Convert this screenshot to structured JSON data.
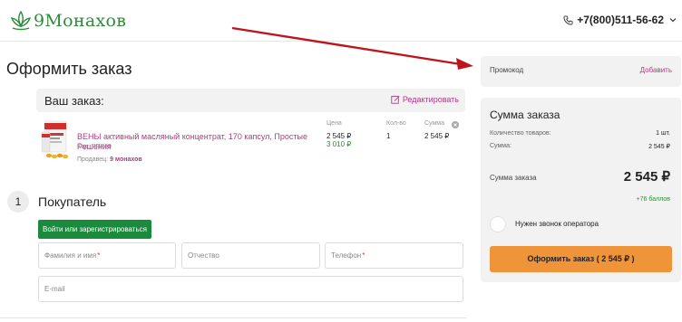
{
  "header": {
    "logo_text": "9Монахов",
    "phone": "+7(800)511-56-62"
  },
  "page": {
    "title": "Оформить заказ"
  },
  "order": {
    "heading": "Ваш заказ:",
    "edit_label": "Редактировать",
    "columns": {
      "price": "Цена",
      "qty": "Кол-во",
      "sum": "Сумма"
    },
    "item": {
      "name": "ВЕНЫ активный масляный концентрат, 170 капсул, Простые Решения",
      "code": "Код: РПР39",
      "seller_label": "Продавец:",
      "seller_name": "9 монахов",
      "price": "2 545 ₽",
      "price_old": "3 010 ₽",
      "qty": "1",
      "sum": "2 545 ₽"
    }
  },
  "buyer": {
    "step_number": "1",
    "title": "Покупатель",
    "login_button": "Войти или зарегистрироваться",
    "fields": {
      "surname_name": "Фамилия и имя",
      "patronymic": "Отчество",
      "phone": "Телефон",
      "email": "E-mail"
    },
    "required_mark": "*"
  },
  "promo": {
    "label": "Промокод",
    "add_label": "Добавить"
  },
  "summary": {
    "title": "Сумма заказа",
    "count_label": "Количество товаров:",
    "count_value": "1 шт.",
    "sum_label": "Сумма:",
    "sum_value": "2 545 ₽",
    "total_label": "Сумма заказа",
    "total_value": "2 545 ₽",
    "bonus": "+76 баллов",
    "call_label": "Нужен звонок оператора",
    "checkout_button": "Оформить заказ ( 2 545 ₽ )"
  },
  "colors": {
    "brand_green": "#2e8b3a",
    "accent_magenta": "#b03a83",
    "checkout_orange": "#f0943a",
    "annotation_arrow": "#c0141c"
  }
}
